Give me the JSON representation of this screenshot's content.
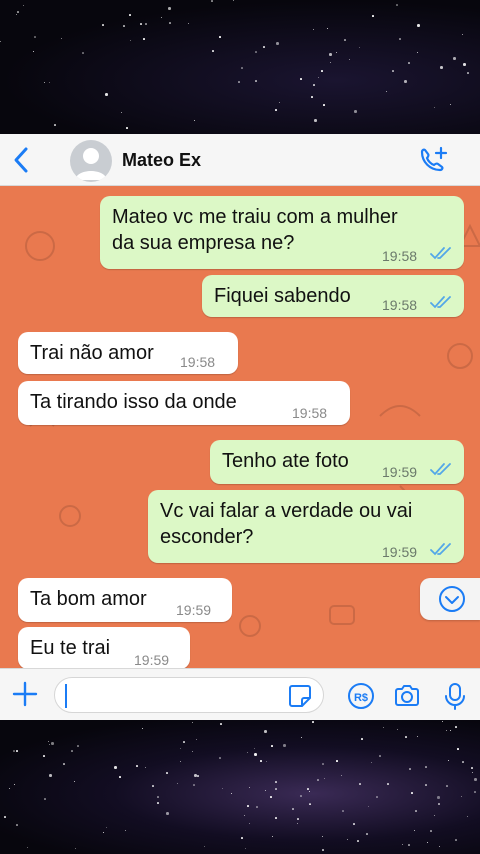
{
  "header": {
    "contact_name": "Mateo Ex",
    "back_icon": "chevron-left-icon",
    "call_icon": "phone-plus-icon"
  },
  "messages": [
    {
      "direction": "out",
      "text": "Mateo vc me traiu com a mulher da sua empresa ne?",
      "time": "19:58",
      "read": true
    },
    {
      "direction": "out",
      "text": "Fiquei sabendo",
      "time": "19:58",
      "read": true
    },
    {
      "direction": "in",
      "text": "Trai não amor",
      "time": "19:58"
    },
    {
      "direction": "in",
      "text": "Ta tirando isso da onde",
      "time": "19:58"
    },
    {
      "direction": "out",
      "text": "Tenho ate foto",
      "time": "19:59",
      "read": true
    },
    {
      "direction": "out",
      "text": "Vc vai falar a verdade ou vai esconder?",
      "time": "19:59",
      "read": true
    },
    {
      "direction": "in",
      "text": "Ta bom amor",
      "time": "19:59"
    },
    {
      "direction": "in",
      "text": "Eu te trai",
      "time": "19:59"
    }
  ],
  "composer": {
    "input_value": "",
    "icons": [
      "plus-icon",
      "sticker-icon",
      "pix-icon",
      "camera-icon",
      "microphone-icon"
    ],
    "pix_label": "R$"
  },
  "colors": {
    "chat_background": "#e9794f",
    "outgoing_bubble": "#dcf8c6",
    "incoming_bubble": "#ffffff",
    "accent_blue": "#1b7cf5",
    "read_ticks": "#53a7e8"
  }
}
